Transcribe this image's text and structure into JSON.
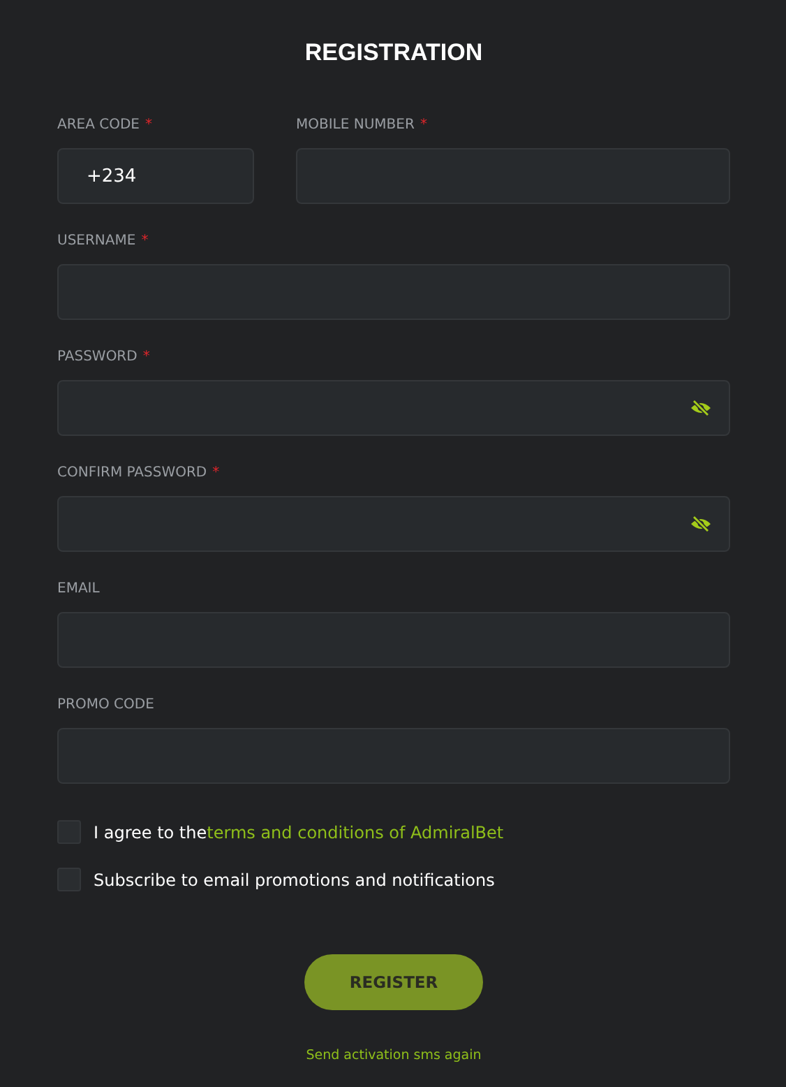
{
  "title": "REGISTRATION",
  "phone": {
    "area_code": {
      "label": "AREA CODE",
      "required_mark": "*",
      "value": "+234"
    },
    "mobile": {
      "label": "MOBILE NUMBER",
      "required_mark": "*"
    }
  },
  "fields": [
    {
      "label": "USERNAME",
      "required_mark": "*",
      "kind": "text"
    },
    {
      "label": "PASSWORD",
      "required_mark": "*",
      "kind": "password"
    },
    {
      "label": "CONFIRM PASSWORD",
      "required_mark": "*",
      "kind": "password"
    },
    {
      "label": "EMAIL",
      "kind": "text"
    },
    {
      "label": "PROMO CODE",
      "kind": "text"
    }
  ],
  "checkboxes": [
    {
      "text": "I agree to the",
      "link": "terms and conditions of AdmiralBet",
      "checked": false
    },
    {
      "text": "Subscribe to email promotions and notifications",
      "checked": false
    }
  ],
  "register_button": "REGISTER",
  "resend_link": "Send activation sms again"
}
